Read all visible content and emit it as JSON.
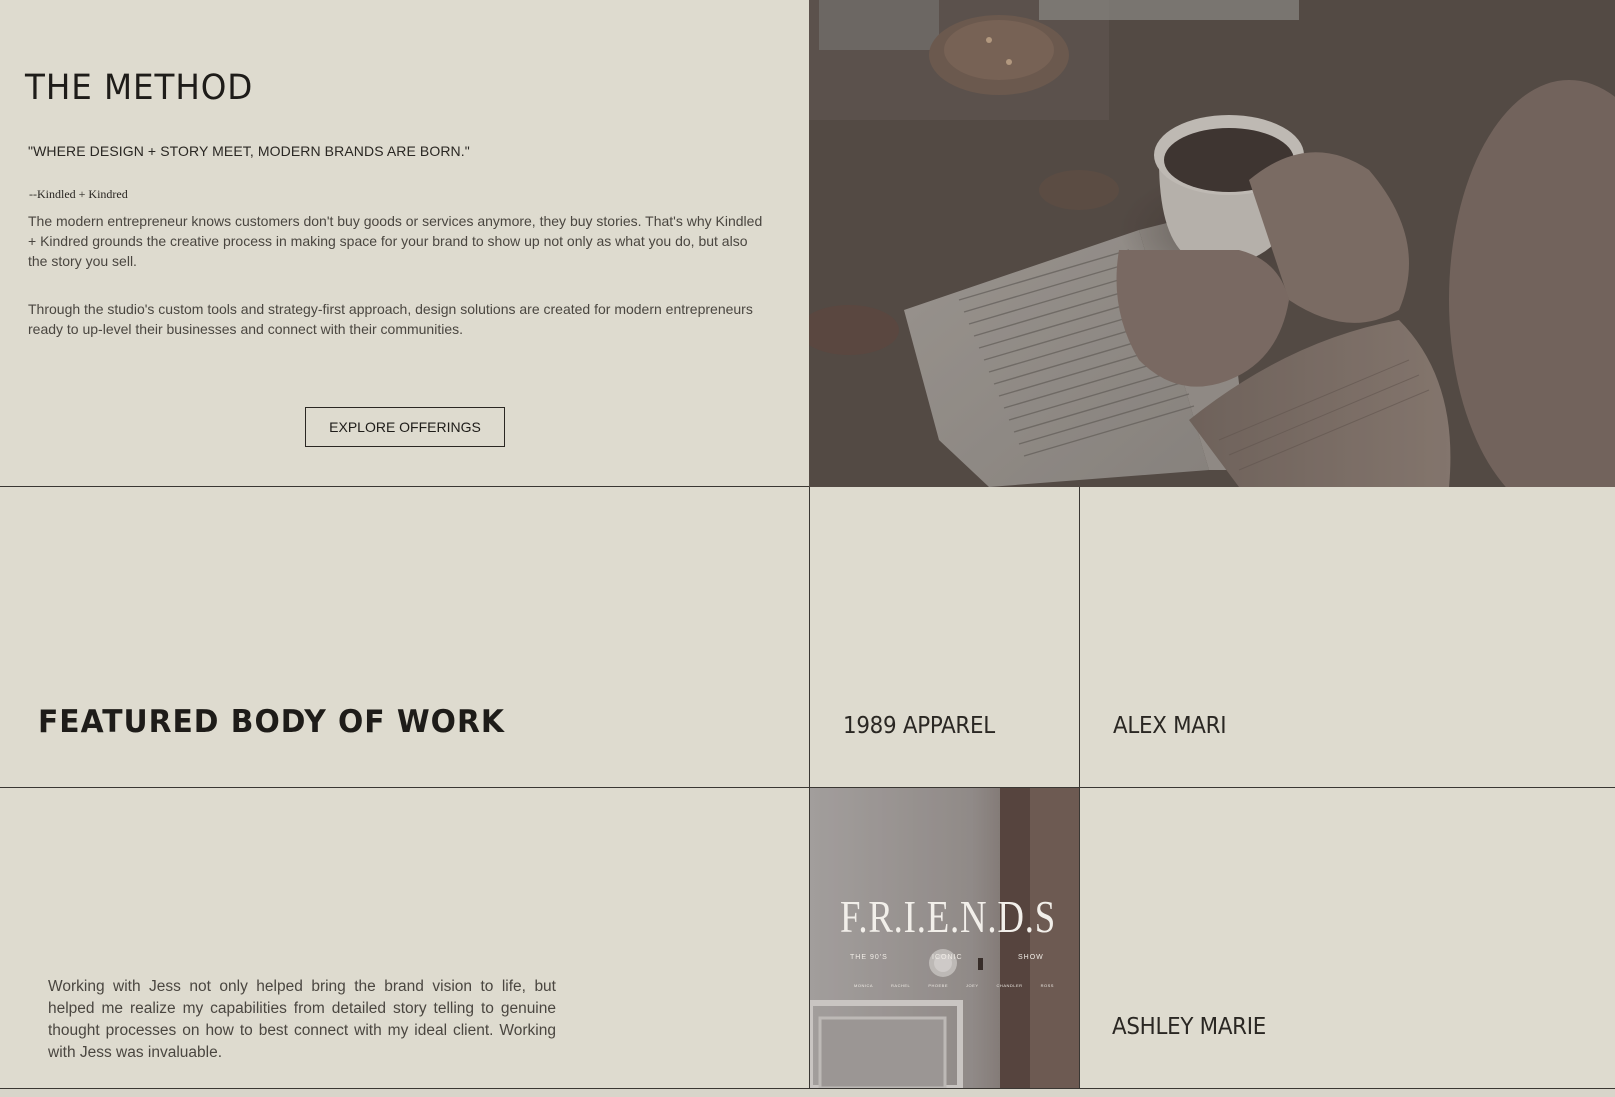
{
  "method": {
    "title": "THE METHOD",
    "quote": "\"WHERE DESIGN + STORY MEET, MODERN BRANDS ARE BORN.\"",
    "attribution": "--Kindled + Kindred",
    "paragraph1": "The modern entrepreneur knows customers don't buy goods or services anymore, they buy stories. That's why Kindled + Kindred grounds the creative process in making space for your brand to show up not only as what you do, but also the story you sell.",
    "paragraph2": "Through the studio's custom tools and strategy-first approach, design solutions are created for modern entrepreneurs ready to up-level their businesses and connect with their communities.",
    "button_label": "EXPLORE OFFERINGS"
  },
  "featured": {
    "title": "FEATURED BODY OF WORK",
    "works": [
      "1989 APPAREL",
      "ALEX MARI",
      "ASHLEY MARIE"
    ],
    "testimonial": "Working with Jess not only helped bring the brand vision to life, but helped me realize my capabilities from detailed story telling to genuine thought processes on how to best connect with my ideal client. Working with Jess was invaluable.",
    "friends_tile": {
      "title": "F.R.I.E.N.D.S",
      "sub_left": "THE 90'S",
      "sub_center": "ICONIC",
      "sub_right": "SHOW",
      "nav": [
        "MONICA",
        "RACHEL",
        "PHOEBE",
        "JOEY",
        "CHANDLER",
        "ROSS"
      ]
    }
  },
  "colors": {
    "background": "#dedbcf",
    "text": "#2a2723",
    "lines": "#3a3733"
  }
}
